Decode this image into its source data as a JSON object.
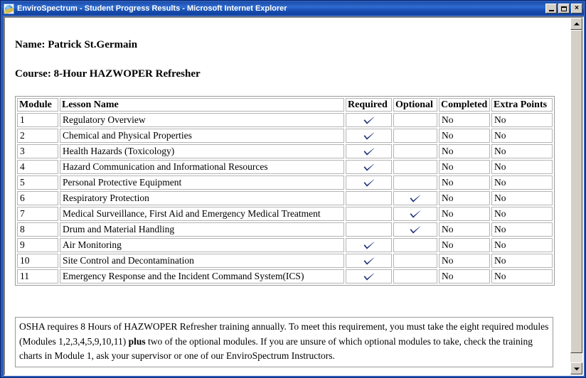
{
  "window": {
    "title": "EnviroSpectrum - Student Progress Results - Microsoft Internet Explorer",
    "icon": "internet-explorer-icon",
    "buttons": {
      "minimize": "_",
      "maximize": "□",
      "close": "×"
    }
  },
  "page": {
    "name_line": "Name: Patrick St.Germain",
    "course_line": "Course: 8-Hour HAZWOPER Refresher",
    "table": {
      "columns": [
        "Module",
        "Lesson Name",
        "Required",
        "Optional",
        "Completed",
        "Extra Points"
      ],
      "rows": [
        {
          "module": "1",
          "lesson": "Regulatory Overview",
          "required": true,
          "optional": false,
          "completed": "No",
          "extra_points": "No"
        },
        {
          "module": "2",
          "lesson": "Chemical and Physical Properties",
          "required": true,
          "optional": false,
          "completed": "No",
          "extra_points": "No"
        },
        {
          "module": "3",
          "lesson": "Health Hazards (Toxicology)",
          "required": true,
          "optional": false,
          "completed": "No",
          "extra_points": "No"
        },
        {
          "module": "4",
          "lesson": "Hazard Communication and Informational Resources",
          "required": true,
          "optional": false,
          "completed": "No",
          "extra_points": "No"
        },
        {
          "module": "5",
          "lesson": "Personal Protective Equipment",
          "required": true,
          "optional": false,
          "completed": "No",
          "extra_points": "No"
        },
        {
          "module": "6",
          "lesson": "Respiratory Protection",
          "required": false,
          "optional": true,
          "completed": "No",
          "extra_points": "No"
        },
        {
          "module": "7",
          "lesson": "Medical Surveillance, First Aid and Emergency Medical Treatment",
          "required": false,
          "optional": true,
          "completed": "No",
          "extra_points": "No"
        },
        {
          "module": "8",
          "lesson": "Drum and Material Handling",
          "required": false,
          "optional": true,
          "completed": "No",
          "extra_points": "No"
        },
        {
          "module": "9",
          "lesson": "Air Monitoring",
          "required": true,
          "optional": false,
          "completed": "No",
          "extra_points": "No"
        },
        {
          "module": "10",
          "lesson": "Site Control and Decontamination",
          "required": true,
          "optional": false,
          "completed": "No",
          "extra_points": "No"
        },
        {
          "module": "11",
          "lesson": "Emergency Response and the Incident Command System(ICS)",
          "required": true,
          "optional": false,
          "completed": "No",
          "extra_points": "No"
        }
      ]
    },
    "note": {
      "part1": "OSHA requires 8 Hours of HAZWOPER Refresher training annually. To meet this requirement, you must take the eight required modules (Modules 1,2,3,4,5,9,10,11) ",
      "bold": "plus",
      "part2": " two of the optional modules. If you are unsure of which optional modules to take, check the training charts in Module 1, ask your supervisor or one of our EnviroSpectrum Instructors."
    }
  },
  "scrollbar": {
    "up_arrow": "scroll-up-arrow",
    "down_arrow": "scroll-down-arrow"
  },
  "colors": {
    "titlebar": "#1d4fab",
    "checkmark": "#1f2f7a",
    "border": "#9a9a9a"
  }
}
